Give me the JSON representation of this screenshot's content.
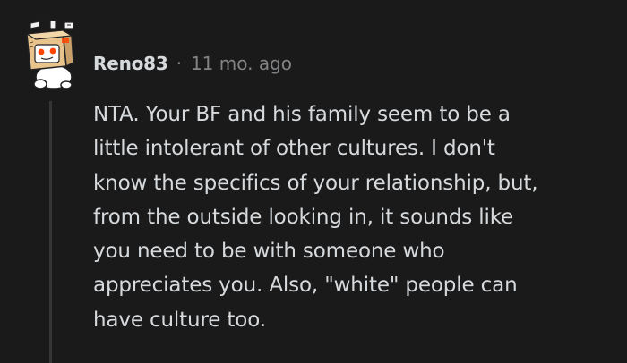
{
  "comment": {
    "avatar_icon": "snoo-box-head-avatar",
    "username": "Reno83",
    "separator": "·",
    "timestamp": "11 mo. ago",
    "body_lines": [
      "NTA. Your BF and his family seem to be a",
      "little intolerant of other cultures. I don't",
      "know the specifics of your relationship, but,",
      "from the outside looking in, it sounds like",
      "you need to be with someone who",
      "appreciates you. Also, \"white\" people can",
      "have culture too."
    ]
  },
  "colors": {
    "background": "#1a1a1b",
    "text_primary": "#d7dadc",
    "text_secondary": "#818384",
    "thread_line": "#343536",
    "avatar_box": "#e8c48c",
    "avatar_accent": "#ff4500"
  }
}
